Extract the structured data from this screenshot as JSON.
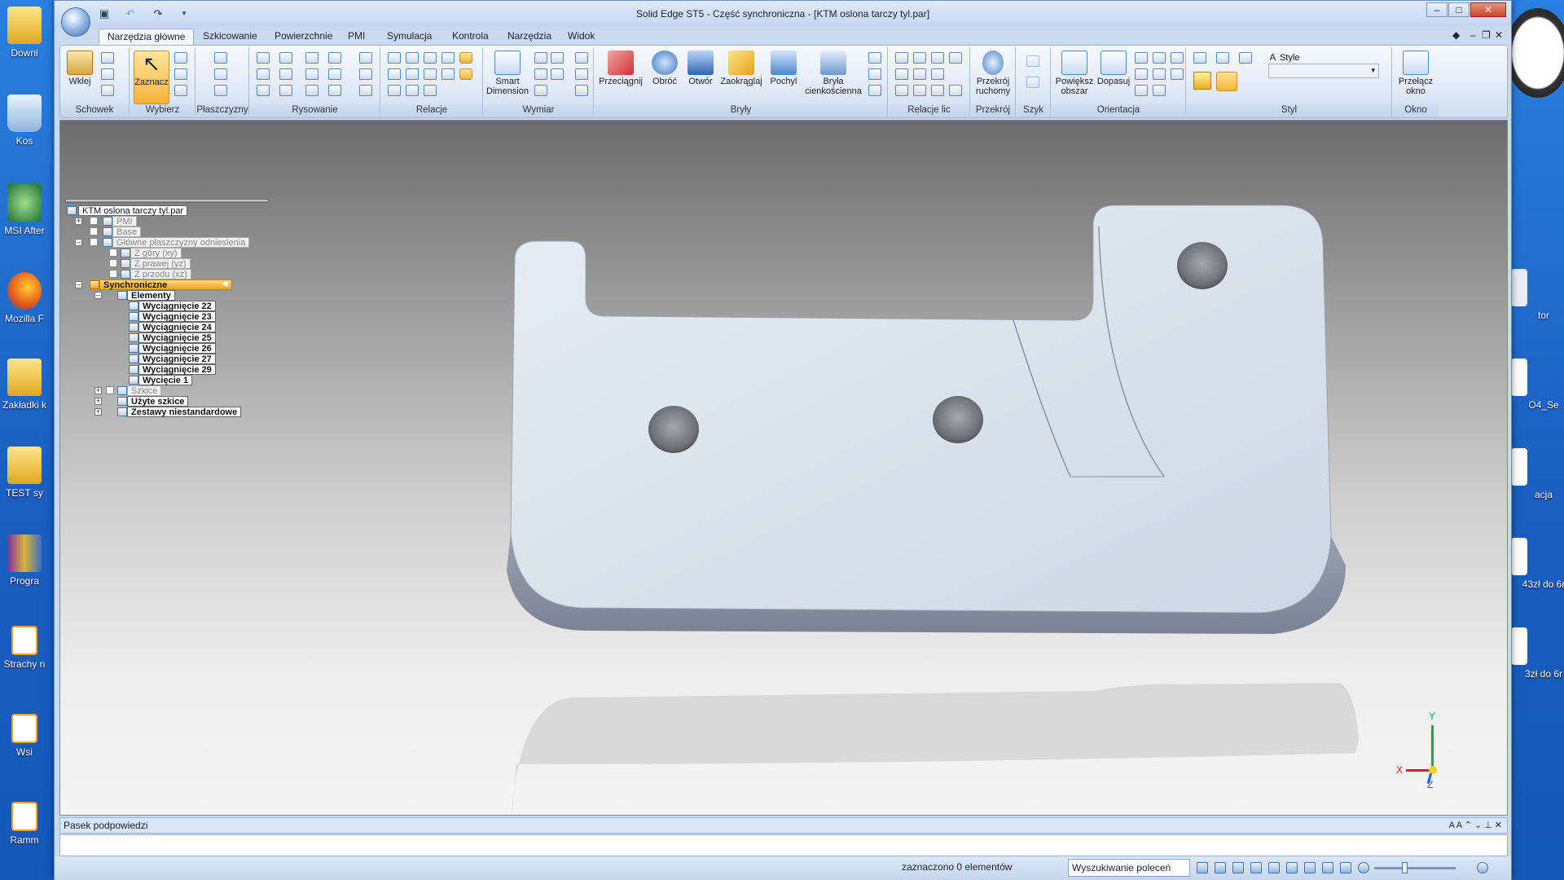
{
  "window": {
    "title": "Solid Edge ST5 - Część synchroniczna - [KTM oslona tarczy tyl.par]"
  },
  "desktop_icons_left": [
    {
      "label": "Downl",
      "icon": "folder-icon"
    },
    {
      "label": "Kos",
      "icon": "recycle-bin-icon"
    },
    {
      "label": "MSI After",
      "icon": "msi-afterburner-icon"
    },
    {
      "label": "Mozilla F",
      "icon": "firefox-icon"
    },
    {
      "label": "Zakładki k",
      "icon": "folder-icon"
    },
    {
      "label": "TEST sy",
      "icon": "folder-icon"
    },
    {
      "label": "Progra",
      "icon": "winrar-icon"
    },
    {
      "label": "Strachy n",
      "icon": "file-icon"
    },
    {
      "label": "Wsi",
      "icon": "file-icon"
    },
    {
      "label": "Ramm",
      "icon": "file-icon"
    }
  ],
  "desktop_icons_right": [
    {
      "label": "tor"
    },
    {
      "label": "O4_Se"
    },
    {
      "label": "acja"
    },
    {
      "label": "43zł do 6r"
    },
    {
      "label": "3zł do 6r"
    }
  ],
  "tabs": [
    "Narzędzia główne",
    "Szkicowanie",
    "Powierzchnie",
    "PMI",
    "Symulacja",
    "Kontrola",
    "Narzędzia",
    "Widok"
  ],
  "ribbon": {
    "groups": {
      "clipboard": "Schowek",
      "select": "Wybierz",
      "planes": "Płaszczyzny",
      "draw": "Rysowanie",
      "relations": "Relacje",
      "dimension": "Wymiar",
      "solids": "Bryły",
      "face_relations": "Relacje lic",
      "section": "Przekrój",
      "pattern": "Szyk",
      "orient": "Orientacja",
      "style": "Styl",
      "window": "Okno"
    },
    "buttons": {
      "paste": "Wklej",
      "select": "Zaznacz",
      "smart_dim_1": "Smart",
      "smart_dim_2": "Dimension",
      "extrude": "Przeciągnij",
      "revolve": "Obróć",
      "hole": "Otwór",
      "round": "Zaokrąglaj",
      "draft": "Pochyl",
      "thin_1": "Bryła",
      "thin_2": "cienkościenna",
      "section_1": "Przekrój",
      "section_2": "ruchomy",
      "zoom_area_1": "Powiększ",
      "zoom_area_2": "obszar",
      "fit": "Dopasuj",
      "switch_win_1": "Przełącz",
      "switch_win_2": "okno"
    },
    "style_label": "Style"
  },
  "tree": {
    "root": "KTM oslona tarczy tyl.par",
    "pmi": "PMI",
    "base": "Base",
    "main_planes": "Główne płaszczyzny odniesienia",
    "plane_top": "Z góry (xy)",
    "plane_right": "Z prawej (yz)",
    "plane_front": "Z przodu (xz)",
    "sync": "Synchroniczne",
    "features": "Elementy",
    "items": [
      "Wyciągnięcie 22",
      "Wyciągnięcie 23",
      "Wyciągnięcie 24",
      "Wyciągnięcie 25",
      "Wyciągnięcie 26",
      "Wyciągnięcie 27",
      "Wyciągnięcie 29",
      "Wycięcie 1"
    ],
    "sketches": "Szkice",
    "used_sketches": "Użyte szkice",
    "custom_sets": "Zestawy niestandardowe"
  },
  "triad": {
    "x": "X",
    "y": "Y",
    "z": "Z"
  },
  "hint_bar": "Pasek podpowiedzi",
  "status": {
    "selected": "zaznaczono 0 elementów",
    "command_search": "Wyszukiwanie poleceń"
  },
  "colors": {
    "accent_orange": "#f6a21e",
    "part_face": "#d6e0ea",
    "part_side": "#8c94a6"
  }
}
